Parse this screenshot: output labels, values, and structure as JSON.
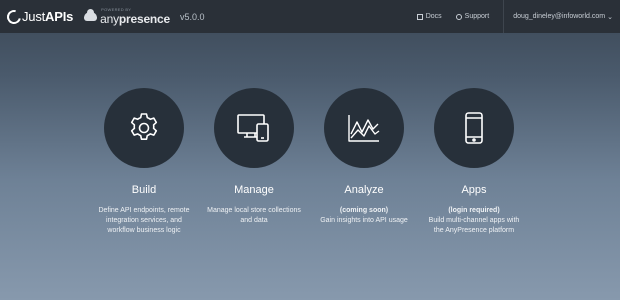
{
  "header": {
    "brand_prefix": "Just",
    "brand_bold": "APIs",
    "partner_tag": "POWERED BY",
    "partner_name_light": "any",
    "partner_name_bold": "presence",
    "version": "v5.0.0",
    "docs_label": "Docs",
    "support_label": "Support",
    "user_email": "doug_dineley@infoworld.com",
    "icons": {
      "docs": "document-icon",
      "support": "lifebuoy-icon",
      "user_menu": "chevron-down-icon"
    }
  },
  "cards": [
    {
      "icon": "gear-icon",
      "title": "Build",
      "note": "",
      "desc": "Define API endpoints, remote integration services, and workflow business logic"
    },
    {
      "icon": "devices-icon",
      "title": "Manage",
      "note": "",
      "desc": "Manage local store collections and data"
    },
    {
      "icon": "chart-icon",
      "title": "Analyze",
      "note": "(coming soon)",
      "desc": "Gain insights into API usage"
    },
    {
      "icon": "phone-icon",
      "title": "Apps",
      "note": "(login required)",
      "desc": "Build multi-channel apps with the AnyPresence platform"
    }
  ],
  "colors": {
    "topbar": "#2a3038",
    "circle": "#27303a",
    "bg_top": "#3a4654",
    "bg_bottom": "#8799ad"
  }
}
